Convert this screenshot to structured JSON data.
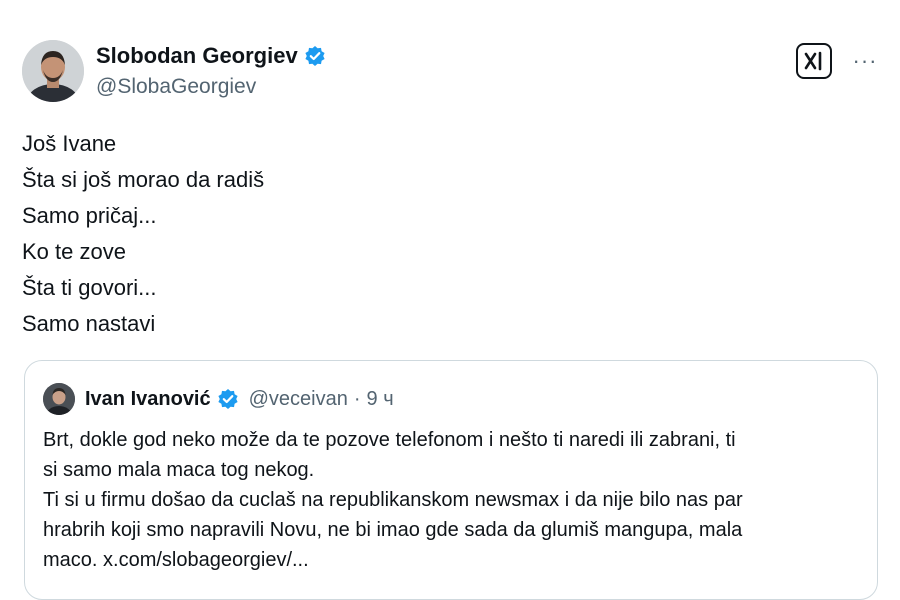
{
  "tweet": {
    "author": {
      "name": "Slobodan Georgiev",
      "handle": "@SlobaGeorgiev",
      "verified": true,
      "avatar_icon": "person-avatar"
    },
    "actions": {
      "grok_icon": "grok-icon",
      "more_icon": "more-options-icon",
      "more_label": "···"
    },
    "text_lines": [
      "Još Ivane",
      "Šta si još morao da radiš",
      "Samo pričaj...",
      "Ko te zove",
      "Šta ti govori...",
      "Samo nastavi"
    ],
    "quote": {
      "author": {
        "name": "Ivan Ivanović",
        "handle": "@veceivan",
        "verified": true,
        "meta_separator": "·",
        "time": "9 ч"
      },
      "text_lines": [
        "Brt, dokle god neko može da te pozove telefonom i nešto ti naredi ili zabrani, ti",
        "si samo mala maca tog nekog.",
        "Ti si u firmu došao da cuclaš na republikanskom newsmax i da nije bilo nas par",
        "hrabrih koji smo napravili Novu, ne bi imao gde sada da glumiš mangupa, mala",
        "maco. x.com/slobageorgiev/..."
      ]
    }
  },
  "colors": {
    "verified_blue": "#1d9bf0",
    "text_primary": "#0f1419",
    "text_secondary": "#536471",
    "border": "#cfd9de"
  }
}
